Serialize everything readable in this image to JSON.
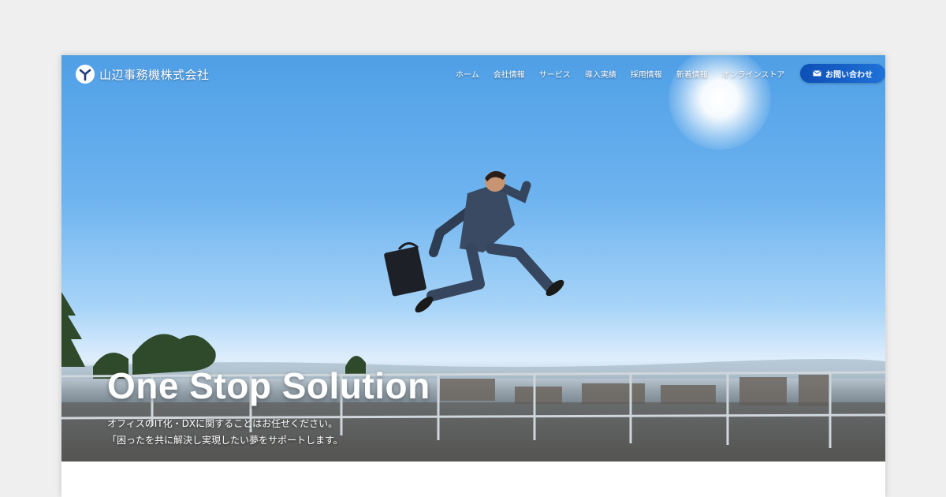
{
  "header": {
    "logo_text": "山辺事務機株式会社",
    "nav": [
      "ホーム",
      "会社情報",
      "サービス",
      "導入実績",
      "採用情報",
      "新着情報",
      "オンラインストア"
    ],
    "contact_label": "お問い合わせ",
    "contact_icon": "mail-icon",
    "accent_color": "#1358c4"
  },
  "hero": {
    "title": "One Stop Solution",
    "subtitle_line1": "オフィスのIT化・DXに関することはお任せください。",
    "subtitle_line2": "「困ったを共に解決し実現したい夢をサポートします。"
  }
}
